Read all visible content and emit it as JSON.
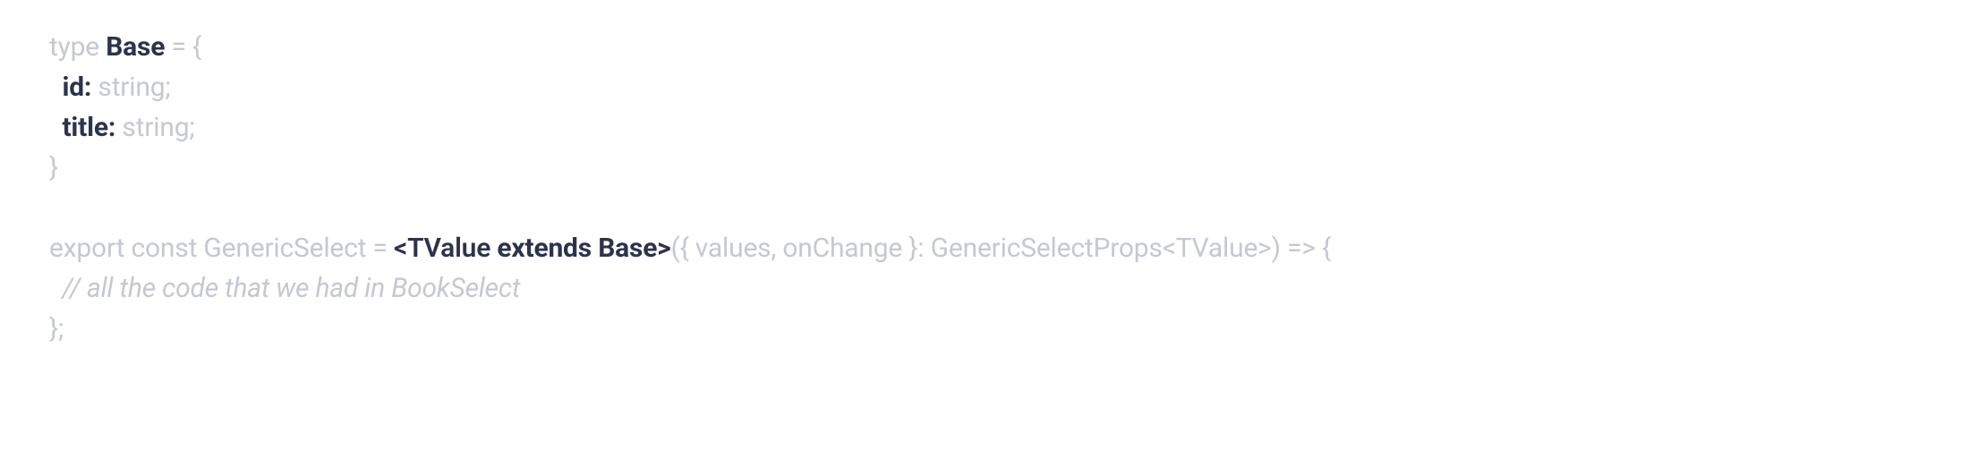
{
  "code": {
    "line1": {
      "t1": "type ",
      "t2": "Base",
      "t3": " = {"
    },
    "line2": {
      "t1": "  ",
      "t2": "id:",
      "t3": " string;"
    },
    "line3": {
      "t1": "  ",
      "t2": "title:",
      "t3": " string;"
    },
    "line4": {
      "t1": "}"
    },
    "line5": {
      "t1": ""
    },
    "line6": {
      "t1": "export const GenericSelect = ",
      "t2": "<TValue ",
      "t3": "extends Base>",
      "t4": "({ values, onChange }: GenericSelectProps<TValue>) => {"
    },
    "line7": {
      "t1": "  ",
      "t2": "// all the code that we had in BookSelect"
    },
    "line8": {
      "t1": "};"
    }
  }
}
